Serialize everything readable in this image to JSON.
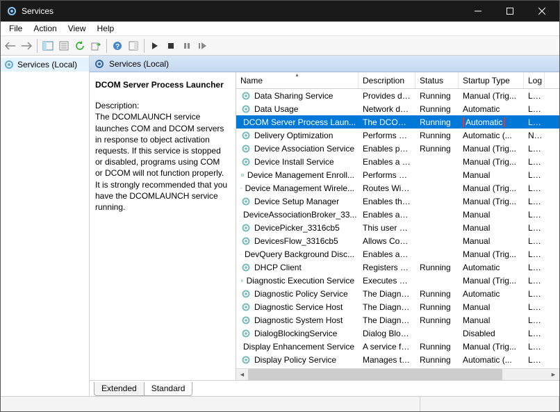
{
  "window": {
    "title": "Services"
  },
  "menu": {
    "file": "File",
    "action": "Action",
    "view": "View",
    "help": "Help"
  },
  "tree": {
    "root": "Services (Local)"
  },
  "right_header": {
    "title": "Services (Local)"
  },
  "detail": {
    "name": "DCOM Server Process Launcher",
    "desc_label": "Description:",
    "desc_text": "The DCOMLAUNCH service launches COM and DCOM servers in response to object activation requests. If this service is stopped or disabled, programs using COM or DCOM will not function properly. It is strongly recommended that you have the DCOMLAUNCH service running."
  },
  "columns": {
    "name": "Name",
    "description": "Description",
    "status": "Status",
    "startup": "Startup Type",
    "logon": "Log"
  },
  "rows": [
    {
      "name": "Data Sharing Service",
      "desc": "Provides da...",
      "status": "Running",
      "startup": "Manual (Trig...",
      "log": "Loca"
    },
    {
      "name": "Data Usage",
      "desc": "Network da...",
      "status": "Running",
      "startup": "Automatic",
      "log": "Loca"
    },
    {
      "name": "DCOM Server Process Laun...",
      "desc": "The DCOML...",
      "status": "Running",
      "startup": "Automatic",
      "log": "Loca",
      "selected": true,
      "highlight_startup": true
    },
    {
      "name": "Delivery Optimization",
      "desc": "Performs co...",
      "status": "Running",
      "startup": "Automatic (...",
      "log": "Netw"
    },
    {
      "name": "Device Association Service",
      "desc": "Enables pair...",
      "status": "Running",
      "startup": "Manual (Trig...",
      "log": "Loca"
    },
    {
      "name": "Device Install Service",
      "desc": "Enables a c...",
      "status": "",
      "startup": "Manual (Trig...",
      "log": "Loca"
    },
    {
      "name": "Device Management Enroll...",
      "desc": "Performs D...",
      "status": "",
      "startup": "Manual",
      "log": "Loca"
    },
    {
      "name": "Device Management Wirele...",
      "desc": "Routes Wire...",
      "status": "",
      "startup": "Manual (Trig...",
      "log": "Loca"
    },
    {
      "name": "Device Setup Manager",
      "desc": "Enables the ...",
      "status": "",
      "startup": "Manual (Trig...",
      "log": "Loca"
    },
    {
      "name": "DeviceAssociationBroker_33...",
      "desc": "Enables app...",
      "status": "",
      "startup": "Manual",
      "log": "Loca"
    },
    {
      "name": "DevicePicker_3316cb5",
      "desc": "This user ser...",
      "status": "",
      "startup": "Manual",
      "log": "Loca"
    },
    {
      "name": "DevicesFlow_3316cb5",
      "desc": "Allows Con...",
      "status": "",
      "startup": "Manual",
      "log": "Loca"
    },
    {
      "name": "DevQuery Background Disc...",
      "desc": "Enables app...",
      "status": "",
      "startup": "Manual (Trig...",
      "log": "Loca"
    },
    {
      "name": "DHCP Client",
      "desc": "Registers an...",
      "status": "Running",
      "startup": "Automatic",
      "log": "Loca"
    },
    {
      "name": "Diagnostic Execution Service",
      "desc": "Executes di...",
      "status": "",
      "startup": "Manual (Trig...",
      "log": "Loca"
    },
    {
      "name": "Diagnostic Policy Service",
      "desc": "The Diagno...",
      "status": "Running",
      "startup": "Automatic",
      "log": "Loca"
    },
    {
      "name": "Diagnostic Service Host",
      "desc": "The Diagno...",
      "status": "Running",
      "startup": "Manual",
      "log": "Loca"
    },
    {
      "name": "Diagnostic System Host",
      "desc": "The Diagno...",
      "status": "Running",
      "startup": "Manual",
      "log": "Loca"
    },
    {
      "name": "DialogBlockingService",
      "desc": "Dialog Bloc...",
      "status": "",
      "startup": "Disabled",
      "log": "Loca"
    },
    {
      "name": "Display Enhancement Service",
      "desc": "A service fo...",
      "status": "Running",
      "startup": "Manual (Trig...",
      "log": "Loca"
    },
    {
      "name": "Display Policy Service",
      "desc": "Manages th...",
      "status": "Running",
      "startup": "Automatic (...",
      "log": "Loca"
    }
  ],
  "tabs": {
    "extended": "Extended",
    "standard": "Standard"
  }
}
